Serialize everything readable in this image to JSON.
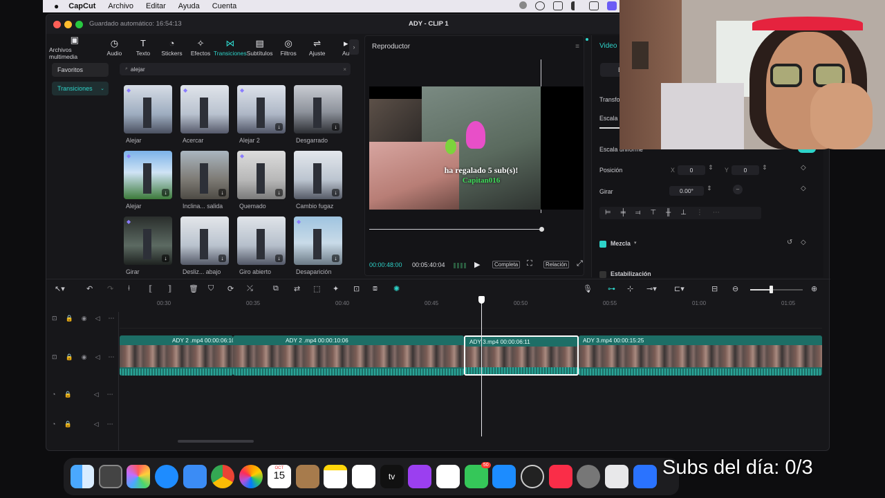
{
  "menubar": {
    "app_name": "CapCut",
    "items": [
      "Archivo",
      "Editar",
      "Ayuda",
      "Cuenta"
    ]
  },
  "window": {
    "autosave": "Guardado automático: 16:54:13",
    "title": "ADY - CLIP 1"
  },
  "toolbar": [
    {
      "label": "Archivos multimedia",
      "icon": "media-icon",
      "glyph": "▣"
    },
    {
      "label": "Audio",
      "icon": "audio-icon",
      "glyph": "◷"
    },
    {
      "label": "Texto",
      "icon": "text-icon",
      "glyph": "T"
    },
    {
      "label": "Stickers",
      "icon": "sticker-icon",
      "glyph": "◔"
    },
    {
      "label": "Efectos",
      "icon": "effects-icon",
      "glyph": "✧"
    },
    {
      "label": "Transiciones",
      "icon": "transitions-icon",
      "glyph": "⋈",
      "active": true
    },
    {
      "label": "Subtítulos",
      "icon": "subtitles-icon",
      "glyph": "▤"
    },
    {
      "label": "Filtros",
      "icon": "filters-icon",
      "glyph": "◎"
    },
    {
      "label": "Ajuste",
      "icon": "adjust-icon",
      "glyph": "⇌"
    },
    {
      "label": "Au",
      "icon": "more-icon",
      "glyph": "▸"
    }
  ],
  "sidebar": {
    "favorites": "Favoritos",
    "transitions": "Transiciones"
  },
  "search": {
    "value": "alejar"
  },
  "transitions": [
    {
      "label": "Alejar",
      "premium": true,
      "download": false
    },
    {
      "label": "Acercar",
      "premium": true,
      "download": false
    },
    {
      "label": "Alejar 2",
      "premium": true,
      "download": true
    },
    {
      "label": "Desgarrado",
      "premium": false,
      "download": true
    },
    {
      "label": "Alejar",
      "premium": true,
      "download": true
    },
    {
      "label": "Inclina... salida",
      "premium": false,
      "download": true
    },
    {
      "label": "Quemado",
      "premium": true,
      "download": true
    },
    {
      "label": "Cambio fugaz",
      "premium": false,
      "download": true
    },
    {
      "label": "Girar",
      "premium": true,
      "download": true
    },
    {
      "label": "Desliz... abajo",
      "premium": false,
      "download": true
    },
    {
      "label": "Giro abierto",
      "premium": false,
      "download": true
    },
    {
      "label": "Desaparición",
      "premium": true,
      "download": true
    }
  ],
  "player": {
    "title": "Reproductor",
    "overlay_line1": "ha regalado 5 sub(s)!",
    "overlay_line2": "Capitan016",
    "current_time": "00:00:48:00",
    "total_time": "00:05:40:04",
    "btn_full": "Completa",
    "btn_ratio": "Relación"
  },
  "inspector": {
    "tab_video": "Video",
    "transform": "Transfo",
    "scale": "Escala",
    "uniform_scale": "Escala uniforme",
    "position_label": "Posición",
    "x_label": "X",
    "x_value": "0",
    "y_label": "Y",
    "y_value": "0",
    "rotate_label": "Girar",
    "rotate_value": "0.00°",
    "blend_label": "Mezcla",
    "stabilize_label": "Estabilización"
  },
  "timeline": {
    "ruler": [
      "00:30",
      "00:35",
      "00:40",
      "00:45",
      "00:50",
      "00:55",
      "01:00",
      "01:05"
    ],
    "clips": [
      {
        "label": "ADY 2 .mp4   00:00:06:10"
      },
      {
        "label": "ADY 2 .mp4   00:00:10:06"
      },
      {
        "label": "ADY 3.mp4   00:00:06:11"
      },
      {
        "label": "ADY 3.mp4   00:00:15:25"
      }
    ]
  },
  "dock": {
    "calendar_month": "OCT",
    "calendar_day": "15",
    "messages_badge": "50",
    "tv_label": "tv"
  },
  "overlay_text": "Subs del día: 0/3",
  "colors": {
    "accent": "#2ed3c9",
    "clip": "#1d6e66",
    "premium": "#8a7cff"
  }
}
